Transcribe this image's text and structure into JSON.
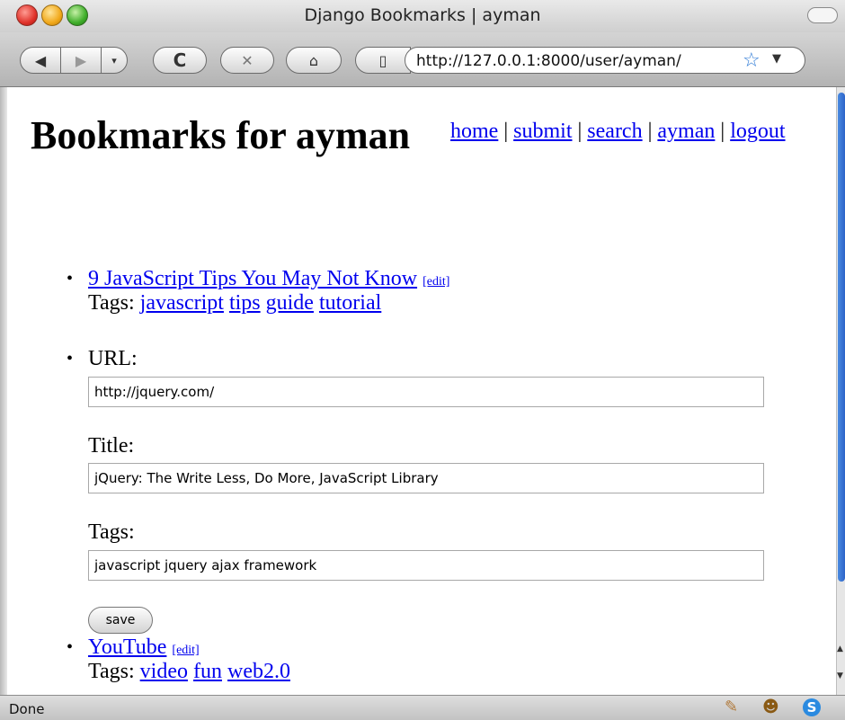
{
  "window": {
    "title": "Django Bookmarks | ayman"
  },
  "toolbar": {
    "back_icon": "◀",
    "forward_icon": "▶",
    "history_dropdown_icon": "▾",
    "reload_icon": "C",
    "stop_icon": "✕",
    "home_icon": "⌂",
    "page_icon": "▯",
    "url": "http://127.0.0.1:8000/user/ayman/",
    "star_icon": "☆",
    "url_dropdown_icon": "▼"
  },
  "page": {
    "heading": "Bookmarks for ayman",
    "nav": {
      "links": [
        "home",
        "submit",
        "search",
        "ayman",
        "logout"
      ],
      "separator": "|"
    },
    "bookmarks": [
      {
        "title": "9 JavaScript Tips You May Not Know",
        "edit": "[edit]",
        "tags_label": "Tags:",
        "tags": [
          "javascript",
          "tips",
          "guide",
          "tutorial"
        ]
      },
      {
        "title": "YouTube",
        "edit": "[edit]",
        "tags_label": "Tags:",
        "tags": [
          "video",
          "fun",
          "web2.0"
        ]
      }
    ],
    "bullet": "•",
    "edit_form": {
      "url_label": "URL:",
      "url_value": "http://jquery.com/",
      "title_label": "Title:",
      "title_value": "jQuery: The Write Less, Do More, JavaScript Library",
      "tags_label": "Tags:",
      "tags_value": "javascript jquery ajax framework",
      "save_label": "save"
    }
  },
  "statusbar": {
    "status": "Done",
    "icons": {
      "addon": "✎",
      "monkey": "☻",
      "s": "S"
    }
  },
  "colors": {
    "link": "#0000ee",
    "accent": "#2c63c9"
  }
}
